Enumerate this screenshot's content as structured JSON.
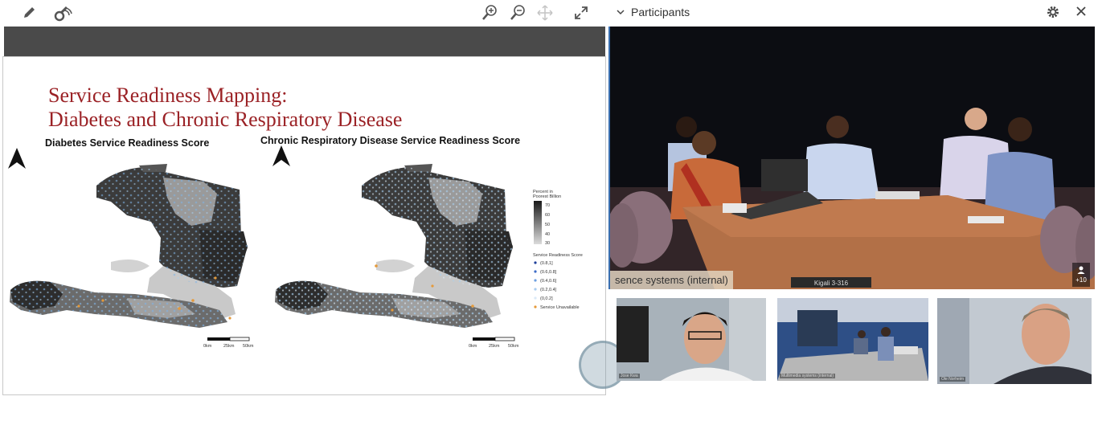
{
  "toolbar": {
    "icons": [
      "pencil-icon",
      "laser-pointer-icon",
      "zoom-in-icon",
      "zoom-out-icon",
      "pan-icon",
      "expand-icon"
    ]
  },
  "slide": {
    "title_line1": "Service Readiness Mapping:",
    "title_line2": "Diabetes and Chronic Respiratory Disease",
    "left_map_title": "Diabetes Service Readiness Score",
    "right_map_title": "Chronic Respiratory Disease Service Readiness Score",
    "legend": {
      "poorest_title_1": "Percent in",
      "poorest_title_2": "Poorest Billion",
      "poorest_ticks": [
        "70",
        "60",
        "50",
        "40",
        "30"
      ],
      "score_title": "Service Readiness Score",
      "score_items": [
        "(0.8,1]",
        "(0.6,0.8]",
        "(0.4,0.6]",
        "(0.2,0.4]",
        "(0,0.2]",
        "Service Unavailable"
      ]
    },
    "scale": [
      "0km",
      "25km",
      "50km"
    ],
    "title_color": "#9b2226"
  },
  "participants": {
    "header_title": "Participants",
    "main_video_label": "sence systems (internal)",
    "room_sign": "Kigali 3-316",
    "count_badge": "+10"
  },
  "thumbnails": [
    {
      "label": "Jose Kwa"
    },
    {
      "label": "Multimedia systems (internal)"
    },
    {
      "label": "Ole Norheim"
    }
  ]
}
